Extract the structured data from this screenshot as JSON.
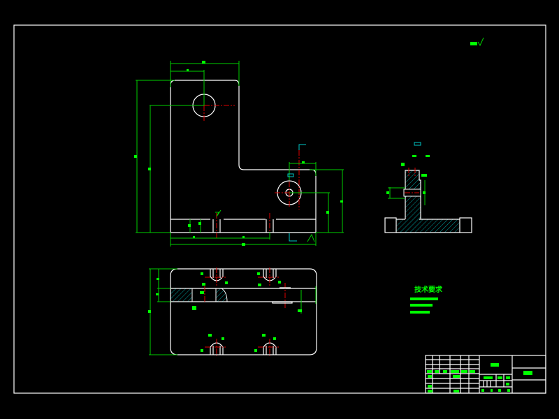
{
  "drawing": {
    "background": "#000000",
    "line_colors": {
      "outline": "#ffffff",
      "dimension": "#00d000",
      "centerline": "#e00000",
      "hatch": "#00c8c8"
    },
    "views": [
      "front-view",
      "side-section-view",
      "top-view"
    ],
    "technical_requirements": {
      "title": "技术要求"
    }
  }
}
